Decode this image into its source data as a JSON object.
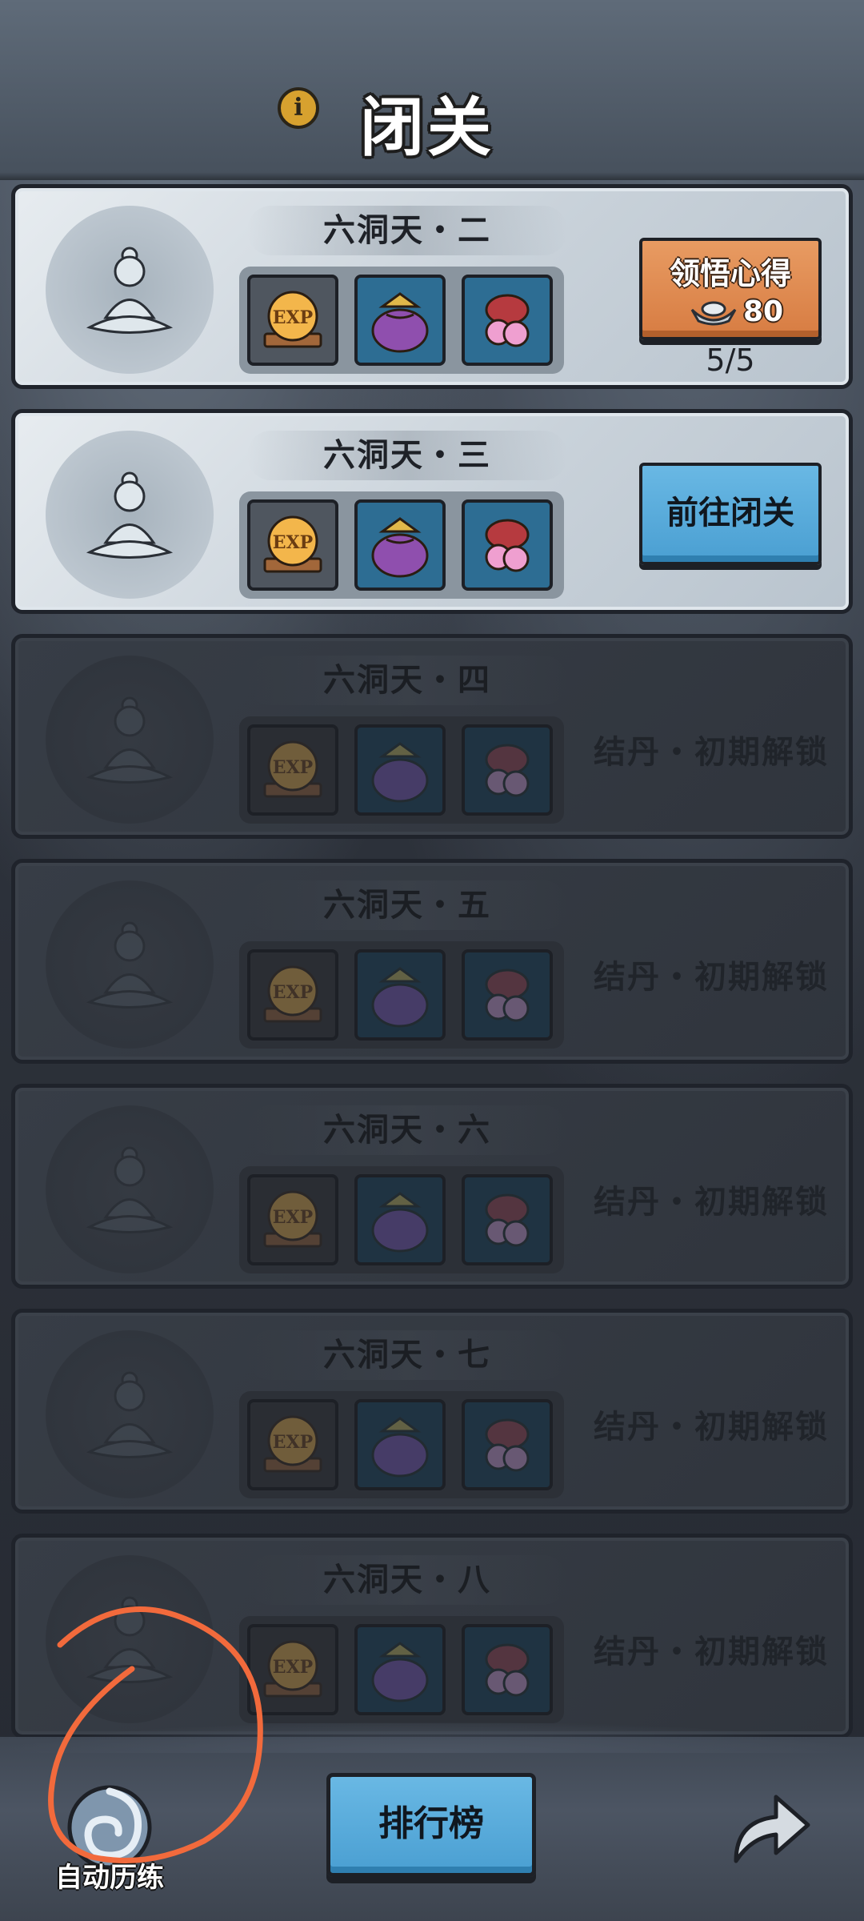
{
  "header": {
    "title": "闭关",
    "info_icon": "info-icon"
  },
  "realms": [
    {
      "name": "六洞天・二",
      "state": "claim",
      "button_label": "领悟心得",
      "cost": "80",
      "progress": "5/5"
    },
    {
      "name": "六洞天・三",
      "state": "go",
      "button_label": "前往闭关"
    },
    {
      "name": "六洞天・四",
      "state": "locked",
      "lock_text": "结丹・初期解锁"
    },
    {
      "name": "六洞天・五",
      "state": "locked",
      "lock_text": "结丹・初期解锁"
    },
    {
      "name": "六洞天・六",
      "state": "locked",
      "lock_text": "结丹・初期解锁"
    },
    {
      "name": "六洞天・七",
      "state": "locked",
      "lock_text": "结丹・初期解锁"
    },
    {
      "name": "六洞天・八",
      "state": "locked",
      "lock_text": "结丹・初期解锁"
    }
  ],
  "reward_icons": [
    "exp-orb-icon",
    "purple-pouch-icon",
    "red-pouch-icon"
  ],
  "reward_exp_text": "EXP",
  "bottom": {
    "auto_train_label": "自动历练",
    "rank_label": "排行榜",
    "share_icon": "share-arrow-icon"
  },
  "colors": {
    "orange_button": "#d77c42",
    "blue_button": "#4a9fd2",
    "annotation": "#f26a3c"
  }
}
